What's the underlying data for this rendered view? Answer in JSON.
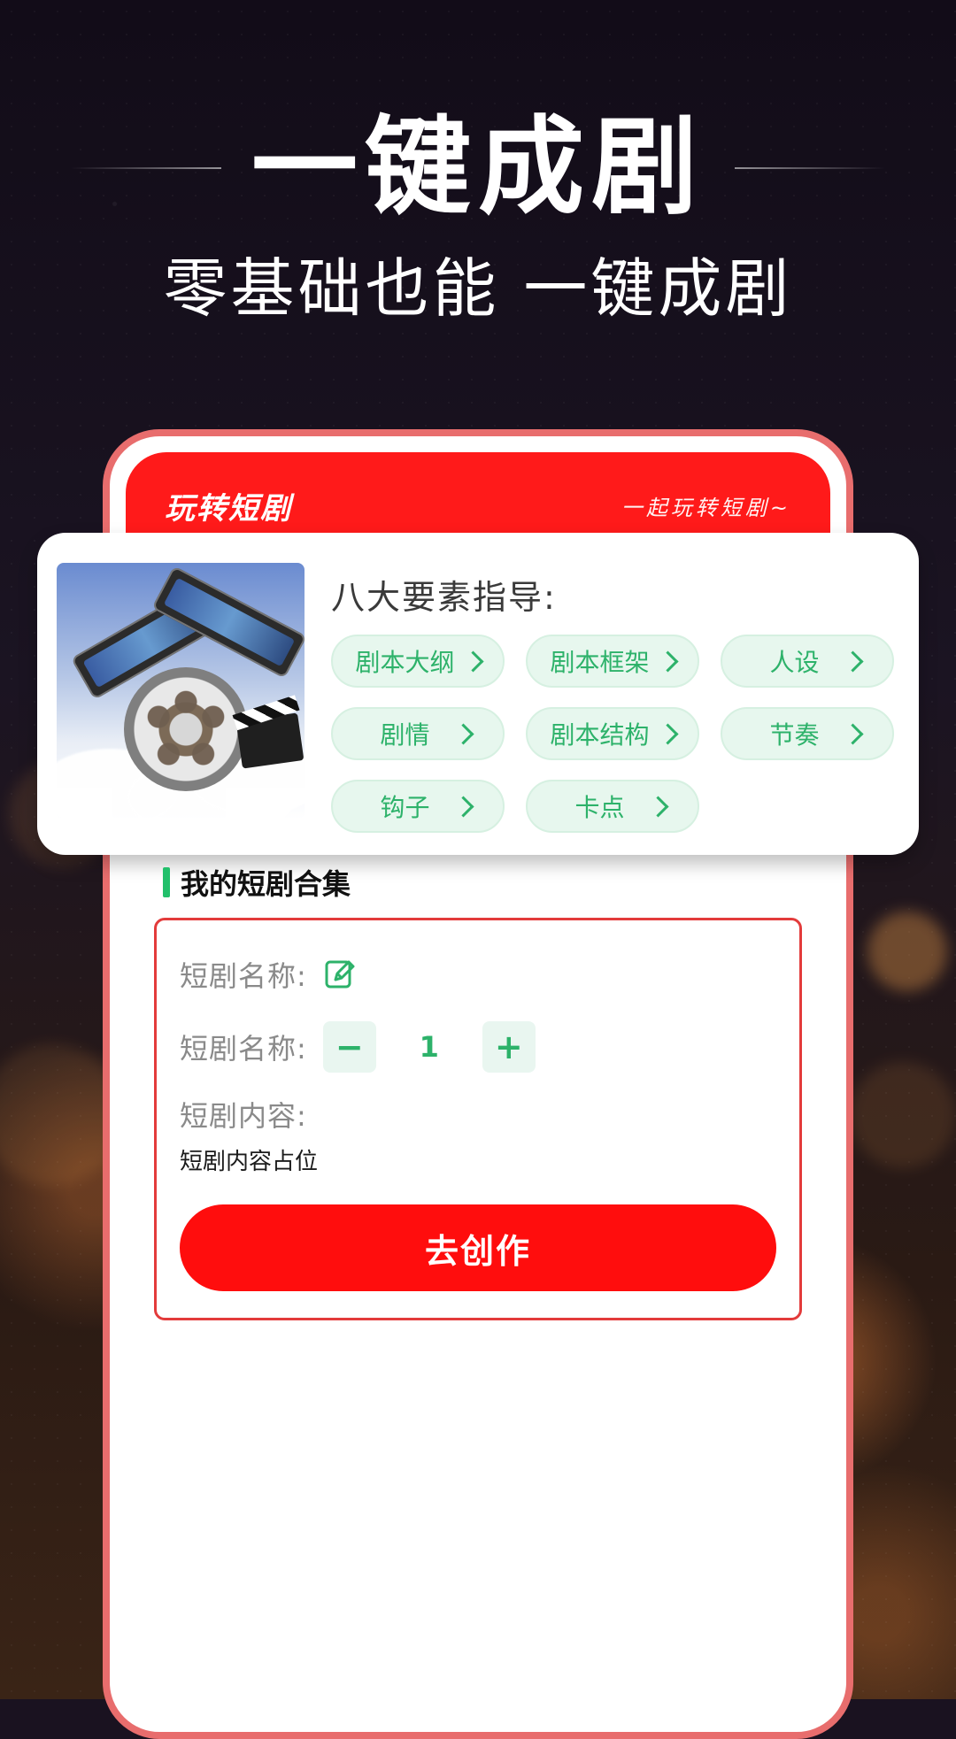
{
  "hero": {
    "title": "一键成剧",
    "subtitle": "零基础也能 一键成剧"
  },
  "app": {
    "header": {
      "title": "玩转短剧",
      "tagline": "一起玩转短剧~"
    }
  },
  "guide": {
    "title": "八大要素指导:",
    "items": [
      {
        "label": "剧本大纲"
      },
      {
        "label": "剧本框架"
      },
      {
        "label": "人设"
      },
      {
        "label": "剧情"
      },
      {
        "label": "剧本结构"
      },
      {
        "label": "节奏"
      },
      {
        "label": "钩子"
      },
      {
        "label": "卡点"
      }
    ],
    "chevron_icon": "chevron-right-icon"
  },
  "collection": {
    "title": "我的短剧合集"
  },
  "form": {
    "name_label": "短剧名称:",
    "count_label": "短剧名称:",
    "count_value": "1",
    "content_label": "短剧内容:",
    "content_placeholder": "短剧内容占位",
    "create_button": "去创作",
    "minus_symbol": "−",
    "plus_symbol": "+"
  },
  "colors": {
    "primary_red": "#ff1a1a",
    "accent_green": "#2db26a",
    "pill_bg": "#e7f7ee",
    "phone_border": "#e86d6d"
  }
}
